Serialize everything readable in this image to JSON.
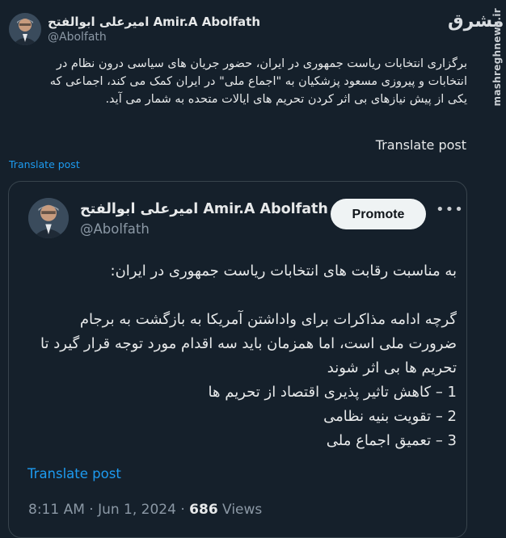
{
  "outer_post": {
    "name": "امیرعلی ابوالفتح Amir.A Abolfath",
    "handle": "@Abolfath",
    "text_lines": [
      "برگزاری انتخابات ریاست جمهوری در ایران، حضور جریان های سیاسی درون نظام در",
      "انتخابات و پیروزی مسعود پزشکیان به \"اجماع ملی\" در ایران کمک می کند، اجماعی که",
      "یکی از پیش نیازهای بی اثر کردن تحریم های ایالات متحده به شمار می آید."
    ],
    "translate_inline": "Translate post",
    "translate_link": "Translate post"
  },
  "watermark": {
    "site": "mashreghnews.ir",
    "logo": "مشرق"
  },
  "quoted_post": {
    "name": "امیرعلی ابوالفتح Amir.A Abolfath",
    "handle": "@Abolfath",
    "promote_label": "Promote",
    "more_label": "•••",
    "paragraph1": "به مناسبت رقابت های انتخابات ریاست جمهوری در ایران:",
    "paragraph2_lines": [
      "گرچه ادامه مذاکرات برای واداشتن آمریکا به بازگشت به برجام",
      "ضرورت ملی است، اما همزمان باید سه اقدام مورد توجه قرار گیرد تا",
      "تحریم ها بی اثر شوند",
      "1 – کاهش تاثیر پذیری اقتصاد از تحریم ها",
      "2 – تقویت بنیه نظامی",
      "3 – تعمیق اجماع ملی"
    ],
    "translate_link": "Translate post",
    "timestamp": "8:11 AM · Jun 1, 2024 · ",
    "views_count": "686",
    "views_label": " Views"
  }
}
